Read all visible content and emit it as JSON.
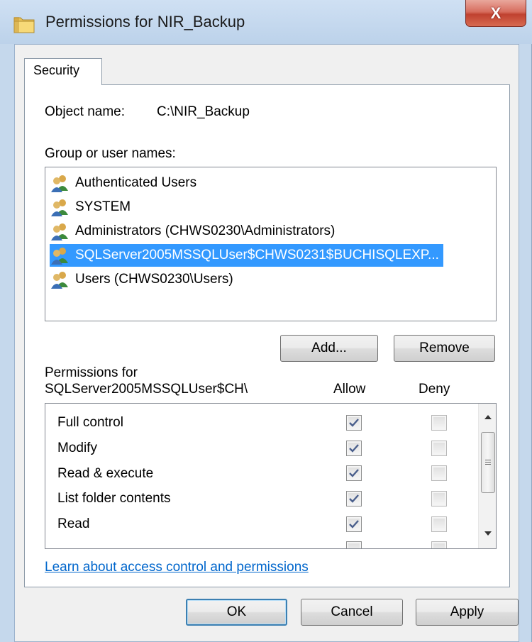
{
  "window": {
    "title": "Permissions for NIR_Backup",
    "close_glyph": "X",
    "icon": "folder-icon"
  },
  "tabs": [
    {
      "label": "Security",
      "selected": true
    }
  ],
  "object": {
    "label": "Object name:",
    "value": "C:\\NIR_Backup"
  },
  "groups": {
    "label": "Group or user names:",
    "items": [
      {
        "label": "Authenticated Users",
        "icon": "users-icon",
        "selected": false
      },
      {
        "label": "SYSTEM",
        "icon": "users-icon",
        "selected": false
      },
      {
        "label": "Administrators (CHWS0230\\Administrators)",
        "icon": "users-icon",
        "selected": false
      },
      {
        "label": "SQLServer2005MSSQLUser$CHWS0231$BUCHISQLEXP...",
        "icon": "users-icon",
        "selected": true
      },
      {
        "label": "Users (CHWS0230\\Users)",
        "icon": "users-icon",
        "selected": false
      }
    ],
    "add_label": "Add...",
    "remove_label": "Remove"
  },
  "permissions": {
    "label_line1": "Permissions for",
    "label_line2": "SQLServer2005MSSQLUser$CH\\",
    "allow_header": "Allow",
    "deny_header": "Deny",
    "rows": [
      {
        "label": "Full control",
        "allow": true,
        "deny": false
      },
      {
        "label": "Modify",
        "allow": true,
        "deny": false
      },
      {
        "label": "Read & execute",
        "allow": true,
        "deny": false
      },
      {
        "label": "List folder contents",
        "allow": true,
        "deny": false
      },
      {
        "label": "Read",
        "allow": true,
        "deny": false
      }
    ]
  },
  "learn_link": "Learn about access control and permissions",
  "buttons": {
    "ok": "OK",
    "cancel": "Cancel",
    "apply": "Apply"
  },
  "colors": {
    "selection": "#3399ff",
    "link": "#0066cc",
    "close_button": "#c7432f",
    "frame": "#c5d8ec"
  }
}
